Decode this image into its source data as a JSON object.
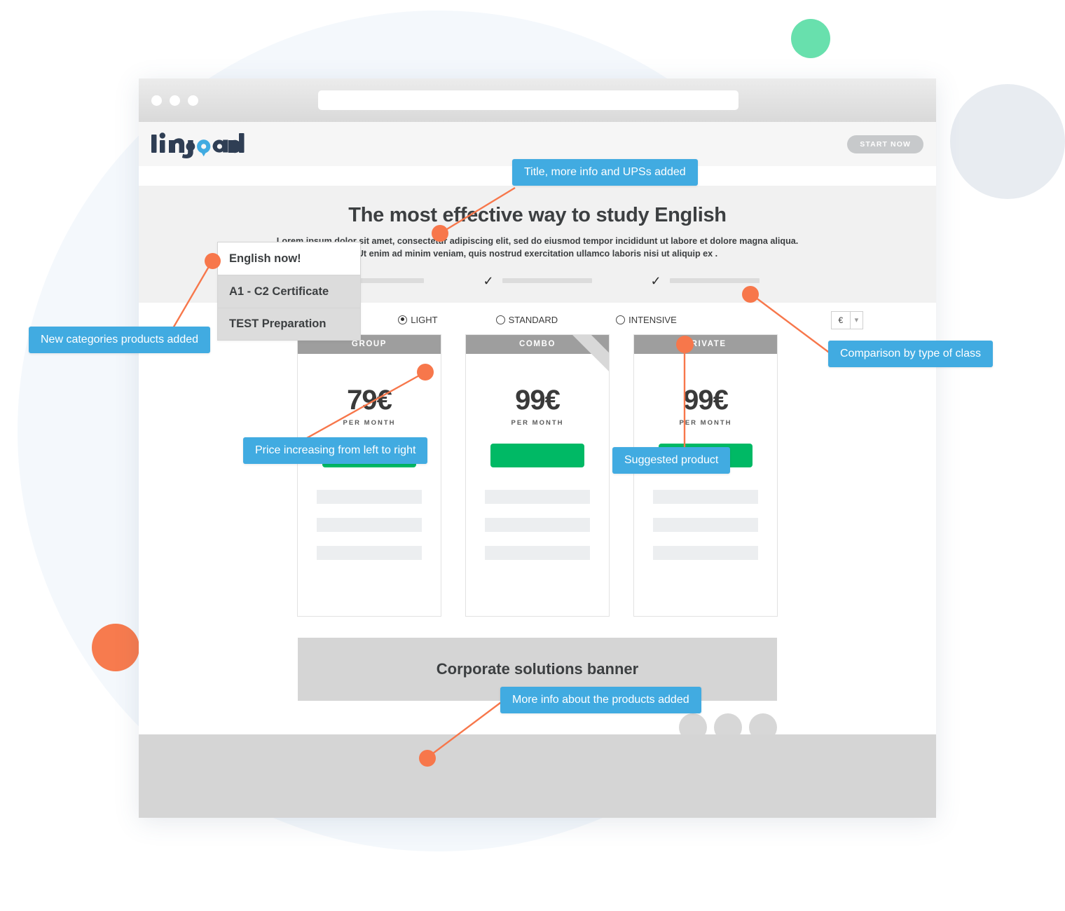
{
  "browser": {
    "traffic_lights": [
      "close",
      "minimize",
      "maximize"
    ],
    "url_value": "",
    "url_placeholder": ""
  },
  "header": {
    "logo_text": "lingoda",
    "start_now_label": "START NOW"
  },
  "hero": {
    "title": "The most effective way to study English",
    "subtitle": "Lorem ipsum dolor sit amet, consectetur adipiscing elit, sed do eiusmod tempor incididunt ut labore et dolore magna aliqua. Ut enim ad minim veniam, quis nostrud exercitation ullamco laboris nisi ut aliquip ex .",
    "ups": [
      {
        "check": "✓",
        "bar": ""
      },
      {
        "check": "✓",
        "bar": ""
      },
      {
        "check": "✓",
        "bar": ""
      }
    ]
  },
  "selector": {
    "options": [
      {
        "label": "LIGHT",
        "selected": true
      },
      {
        "label": "STANDARD",
        "selected": false
      },
      {
        "label": "INTENSIVE",
        "selected": false
      }
    ],
    "currency": {
      "value": "€",
      "caret": "⌄"
    }
  },
  "cards": [
    {
      "name": "GROUP",
      "price": "79€",
      "period": "PER MONTH",
      "cta_label": "",
      "suggested": false
    },
    {
      "name": "COMBO",
      "price": "99€",
      "period": "PER MONTH",
      "cta_label": "",
      "suggested": true
    },
    {
      "name": "PRIVATE",
      "price": "99€",
      "period": "PER MONTH",
      "cta_label": "",
      "suggested": false
    }
  ],
  "banner": {
    "text": "Corporate solutions banner"
  },
  "categories": [
    {
      "label": "English now!",
      "active": true
    },
    {
      "label": "A1 - C2 Certificate",
      "active": false
    },
    {
      "label": "TEST Preparation",
      "active": false
    }
  ],
  "annotations": [
    {
      "id": "title-ups",
      "text": "Title, more info and UPSs added"
    },
    {
      "id": "categories",
      "text": "New categories products added"
    },
    {
      "id": "price-order",
      "text": "Price increasing from left to right"
    },
    {
      "id": "suggested",
      "text": "Suggested product"
    },
    {
      "id": "comparison",
      "text": "Comparison by type of class"
    },
    {
      "id": "more-info",
      "text": "More info about the products added"
    }
  ],
  "colors": {
    "accent_blue": "#41abe1",
    "accent_orange": "#f7774b",
    "cta_green": "#00b965",
    "logo_dark": "#2f3e54",
    "logo_blue": "#41abe1",
    "banner_gray": "#d5d5d5"
  }
}
